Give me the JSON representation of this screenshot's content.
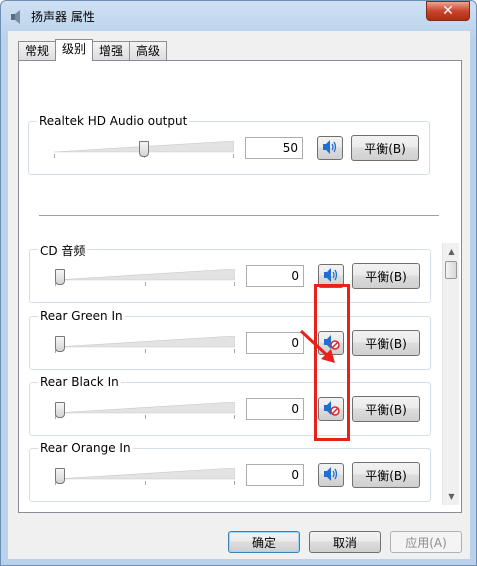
{
  "window": {
    "title": "扬声器 属性",
    "close_label": "✕"
  },
  "tabs": [
    {
      "label": "常规",
      "active": false
    },
    {
      "label": "级别",
      "active": true
    },
    {
      "label": "增强",
      "active": false
    },
    {
      "label": "高级",
      "active": false
    }
  ],
  "master": {
    "label": "Realtek HD Audio output",
    "value": "50",
    "level": 50,
    "balance_label": "平衡(B)",
    "muted": false
  },
  "channels": [
    {
      "label": "CD 音频",
      "value": "0",
      "level": 0,
      "balance_label": "平衡(B)",
      "muted": false
    },
    {
      "label": "Rear Green In",
      "value": "0",
      "level": 0,
      "balance_label": "平衡(B)",
      "muted": true
    },
    {
      "label": "Rear Black In",
      "value": "0",
      "level": 0,
      "balance_label": "平衡(B)",
      "muted": true
    },
    {
      "label": "Rear Orange In",
      "value": "0",
      "level": 0,
      "balance_label": "平衡(B)",
      "muted": false
    }
  ],
  "footer": {
    "ok_label": "确定",
    "cancel_label": "取消",
    "apply_label": "应用(A)"
  },
  "colors": {
    "speaker_blue": "#1f6fd1",
    "mute_red": "#d8262a",
    "annotation_red": "#e8211a"
  }
}
